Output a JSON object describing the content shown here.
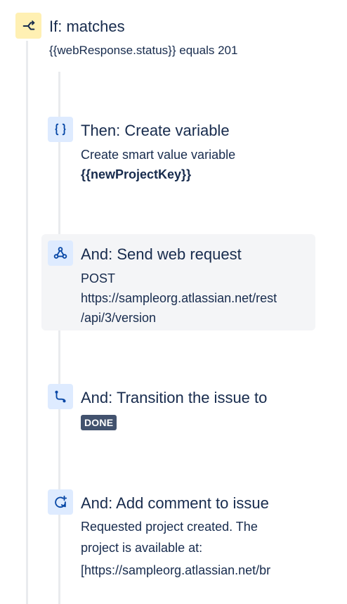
{
  "condition": {
    "title": "If: matches",
    "description": "{{webResponse.status}} equals 201",
    "icon": "branch-icon",
    "color": "#fff0b3"
  },
  "steps": [
    {
      "title": "Then: Create variable",
      "description_line1": "Create smart value variable",
      "description_line2": "{{newProjectKey}}",
      "icon": "curly-braces-icon"
    },
    {
      "title": "And: Send web request",
      "description_line1": "POST",
      "description_line2": "https://sampleorg.atlassian.net/rest",
      "description_line3": "/api/3/version",
      "icon": "webhook-icon",
      "selected": true
    },
    {
      "title": "And: Transition the issue to",
      "status_lozenge": "DONE",
      "icon": "transition-icon"
    },
    {
      "title": "And: Add comment to issue",
      "description_line1": "Requested project created. The",
      "description_line2": "project is available at:",
      "description_line3": "[https://sampleorg.atlassian.net/br",
      "icon": "add-comment-icon"
    }
  ],
  "colors": {
    "text": "#172b4d",
    "action_icon_bg": "#deebff",
    "icon_fg": "#0747a6",
    "selected_bg": "#f4f5f7",
    "connector": "#e9ebee",
    "lozenge_bg": "#42526e"
  }
}
